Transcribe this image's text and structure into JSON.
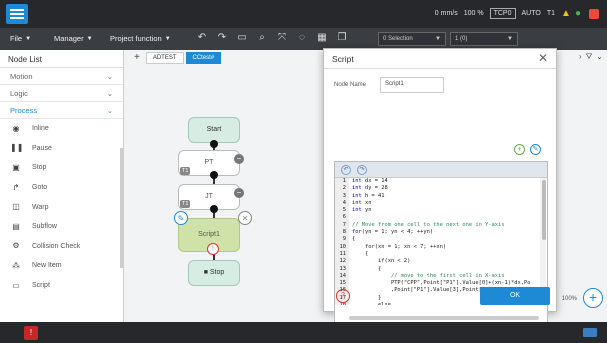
{
  "status": {
    "speed": "0 mm/s",
    "percent": "100 %",
    "tcp": "TCP0",
    "mode": "AUTO",
    "ti": "T1"
  },
  "menu": {
    "file": "File",
    "manager": "Manager",
    "project_function": "Project function",
    "dropdown1": "0 Selection",
    "dropdown2": "1 (0)"
  },
  "left": {
    "title": "Node List",
    "categories": [
      "Motion",
      "Logic",
      "Process"
    ],
    "items": [
      "Inline",
      "Pause",
      "Stop",
      "Goto",
      "Warp",
      "Subflow",
      "Collision Check",
      "New Item",
      "Script"
    ]
  },
  "tabs": [
    "ADTEST",
    "CCtest#"
  ],
  "flow": {
    "start": "Start",
    "pt": "PT",
    "jt": "JT",
    "script": "Script1",
    "stop": "Stop",
    "badge1": "T1",
    "badge2": "T1"
  },
  "zoom": "100%",
  "dialog": {
    "title": "Script",
    "node_name_label": "Node Name",
    "node_name_value": "Script1",
    "ok": "OK",
    "code": [
      {
        "n": "1",
        "k": "int",
        "t": " dx = 14"
      },
      {
        "n": "2",
        "k": "int",
        "t": " dy = 28"
      },
      {
        "n": "3",
        "k": "int",
        "t": " h = 41"
      },
      {
        "n": "4",
        "k": "int",
        "t": " xn"
      },
      {
        "n": "5",
        "k": "int",
        "t": " yn"
      },
      {
        "n": "6",
        "k": "",
        "t": ""
      },
      {
        "n": "7",
        "c": "// Move from one cell to the next one in Y-axis"
      },
      {
        "n": "8",
        "k": "for",
        "t": "(yn = 1; yn < 4; ++yn)"
      },
      {
        "n": "9",
        "k": "",
        "t": "{"
      },
      {
        "n": "10",
        "k": "",
        "t": "    for(xn = 1; xn < 7; ++xn)"
      },
      {
        "n": "11",
        "k": "",
        "t": "    {"
      },
      {
        "n": "12",
        "k": "",
        "t": "        if(xn < 2)"
      },
      {
        "n": "13",
        "k": "",
        "t": "        {"
      },
      {
        "n": "14",
        "c": "            // move to the first cell in X-axis"
      },
      {
        "n": "15",
        "k": "",
        "t": "            PTP(\"CPP\",Point[\"P1\"].Value[0]+(xn-1)*dx,Po"
      },
      {
        "n": "16",
        "k": "",
        "t": "            ,Point[\"P1\"].Value[3],Point[\"P1\"].Value[4],"
      },
      {
        "n": "17",
        "k": "",
        "t": "        }"
      },
      {
        "n": "18",
        "k": "",
        "t": "        else"
      },
      {
        "n": "19",
        "k": "",
        "t": "        {"
      }
    ]
  }
}
